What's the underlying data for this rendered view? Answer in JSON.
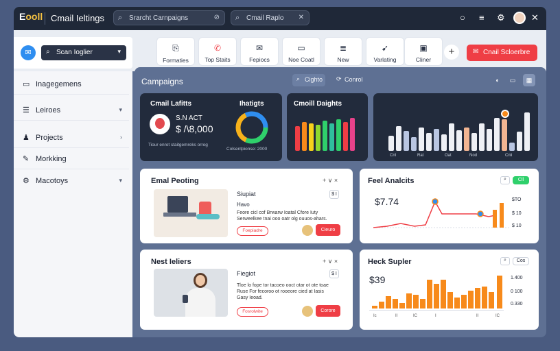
{
  "app": {
    "logo_a": "E",
    "logo_b": "ooll",
    "title": "Cmail Ieltings"
  },
  "topbar": {
    "search1": "Srarcht Carnpaigns",
    "search2": "Cmail Raplo"
  },
  "profile": {
    "dropdown": "Scan Ioglier"
  },
  "toolbar": {
    "tiles": [
      {
        "icon": "⎘",
        "label": "Formaties"
      },
      {
        "icon": "✆",
        "label": "Top Staits"
      },
      {
        "icon": "✉",
        "label": "Fepiocs"
      },
      {
        "icon": "▭",
        "label": "Noe Coatl"
      },
      {
        "icon": "≣",
        "label": "New"
      },
      {
        "icon": "➹",
        "label": "Varlating"
      },
      {
        "icon": "▣",
        "label": "Cliner"
      }
    ],
    "primary": "Cnail Scloerbre"
  },
  "sidebar": {
    "items": [
      {
        "icon": "▭",
        "label": "Inagegemens"
      },
      {
        "icon": "☰",
        "label": "Leiroes"
      },
      {
        "icon": "♟",
        "label": "Projects"
      },
      {
        "icon": "✎",
        "label": "Morkking"
      },
      {
        "icon": "⚙",
        "label": "Macotoys"
      }
    ]
  },
  "main": {
    "title": "Campaigns",
    "chip1": "Cighto",
    "chip2": "Conrol"
  },
  "summary": {
    "title": "Cmail Lafitts",
    "stat_label": "S.N ACT",
    "stat_value": "$ /\\8,000",
    "donut_label": "Ihatigts",
    "footer_left": "Tiour enrot staitgemreks orrog",
    "footer_right": "Colsentpionse: 2000"
  },
  "bars_card": {
    "title": "Cmoill Daights"
  },
  "column_card": {
    "labels": [
      "Cnl",
      "Rat",
      "Oat",
      "Nod",
      "Cnli"
    ]
  },
  "email_card": {
    "title": "Emal Peoting",
    "field": "Siupiat",
    "sub": "Havo",
    "body": "Feore cicl cof Brwarw Ioatal Cfore Iuty Serweelkee tnai ooo oatr olg ouuos-ahars.",
    "pill": "Foepiadre",
    "action": "Cieuro",
    "badge": "$ I"
  },
  "feel_card": {
    "title": "Feel Analcits",
    "chip": "Cll",
    "value": "$7.74",
    "ticks": [
      "$TO",
      "$ 10",
      "$ 10"
    ]
  },
  "news_card": {
    "title": "Nest Ieliers",
    "field": "Fiegiot",
    "body": "Tloe lo fope tor tacoeo ooct otar ot ote toae Ruse For fecoroo ot rooeore cied at Iasis Gasy Ieoad.",
    "pill": "Fosrolwite",
    "action": "Corore",
    "badge": "$ I"
  },
  "heck_card": {
    "title": "Heck Supler",
    "chip": "Cos",
    "value": "$39",
    "ticks": [
      "1.400",
      "0 100",
      "0.330"
    ],
    "xlabels": [
      "Ic",
      "II",
      "IC",
      "I",
      "II",
      "IC"
    ]
  },
  "colors": {
    "accent_red": "#ef3e45",
    "accent_blue": "#2f8ef0",
    "accent_orange": "#f78a1b",
    "accent_green": "#2fd06b"
  }
}
